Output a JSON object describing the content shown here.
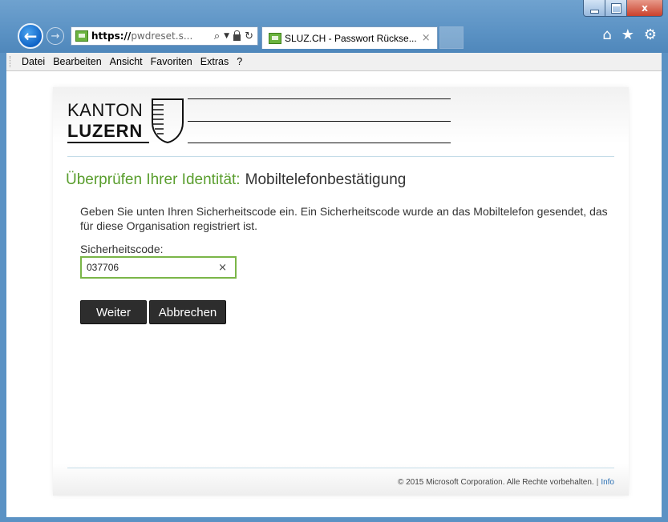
{
  "browser": {
    "address": {
      "https": "https://",
      "rest": "pwdreset.s...",
      "search_icon": "⌕",
      "refresh_icon": "↻"
    },
    "tab": {
      "title": "SLUZ.CH - Passwort Rückse...",
      "close": "×"
    },
    "icons": [
      "home-icon",
      "star-icon",
      "gear-icon"
    ],
    "window_close": "x"
  },
  "menu": [
    "Datei",
    "Bearbeiten",
    "Ansicht",
    "Favoriten",
    "Extras",
    "?"
  ],
  "logo": {
    "line1": "KANTON",
    "line2": "LUZERN"
  },
  "page": {
    "heading_part1": "Überprüfen Ihrer Identität:",
    "heading_part2": "Mobiltelefonbestätigung",
    "intro": "Geben Sie unten Ihren Sicherheitscode ein. Ein Sicherheitscode wurde an das Mobiltelefon gesendet, das für diese Organisation registriert ist.",
    "code_label": "Sicherheitscode:",
    "code_value": "037706",
    "clear_symbol": "×",
    "next_button": "Weiter",
    "cancel_button": "Abbrechen"
  },
  "footer": {
    "copyright": "© 2015 Microsoft Corporation. Alle Rechte vorbehalten.",
    "separator": "|",
    "info_link": "Info"
  },
  "colors": {
    "accent_green": "#5a9e2e",
    "input_border": "#7ab648",
    "frame_blue": "#5b92c4",
    "link_blue": "#2a6fb3"
  }
}
